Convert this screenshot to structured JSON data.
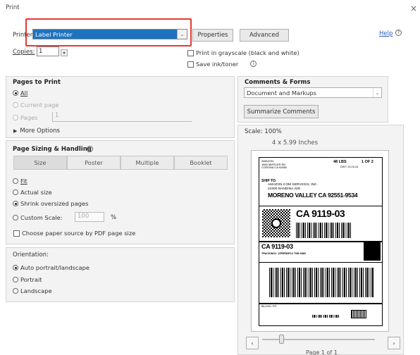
{
  "window": {
    "title": "Print",
    "close_glyph": "×"
  },
  "printer": {
    "label": "Printer:",
    "value": "Label Printer",
    "properties": "Properties",
    "advanced": "Advanced",
    "help": "Help"
  },
  "copies": {
    "label": "Copies:",
    "value": "1"
  },
  "options": {
    "grayscale": "Print in grayscale (black and white)",
    "save_ink": "Save ink/toner"
  },
  "pages_to_print": {
    "title": "Pages to Print",
    "all": "All",
    "current_page": "Current page",
    "pages": "Pages",
    "pages_value": "1",
    "more_options": "More Options"
  },
  "sizing": {
    "title": "Page Sizing & Handling",
    "tabs": [
      "Size",
      "Poster",
      "Multiple",
      "Booklet"
    ],
    "fit": "Fit",
    "actual_size": "Actual size",
    "shrink": "Shrink oversized pages",
    "custom_scale": "Custom Scale:",
    "custom_value": "100",
    "percent": "%",
    "paper_source": "Choose paper source by PDF page size"
  },
  "orientation": {
    "title": "Orientation:",
    "auto": "Auto portrait/landscape",
    "portrait": "Portrait",
    "landscape": "Landscape"
  },
  "comments": {
    "title": "Comments & Forms",
    "value": "Document and Markups",
    "summarize": "Summarize Comments"
  },
  "preview": {
    "scale": "Scale: 100%",
    "size": "4 x 5.99 Inches",
    "page": "Page 1 of 1"
  },
  "shipping_label": {
    "header_left_1": "AMAZON",
    "header_left_2": "1850 MERCER RD",
    "header_left_3": "CORONA CA 92880",
    "weight": "48 LBS",
    "count": "1 OF 2",
    "dims": "DWT: 24,16,16",
    "ship_to_label": "SHIP TO:",
    "ship_to_name": "AMAZON.COM SERVICES, INC.",
    "ship_to_street": "24300 NANDINA AVE",
    "ship_to_city": "MORENO VALLEY CA 92551-9534",
    "code": "CA 9119-03",
    "code2": "CA 9119-03",
    "tracking": "TRACKING#: 1ZR9F86E1X 7056 6883",
    "billing": "BILLING: P/P"
  },
  "colors": {
    "highlight_border": "#e53935",
    "selected_bg": "#1e73be",
    "link": "#2b5eb8"
  }
}
